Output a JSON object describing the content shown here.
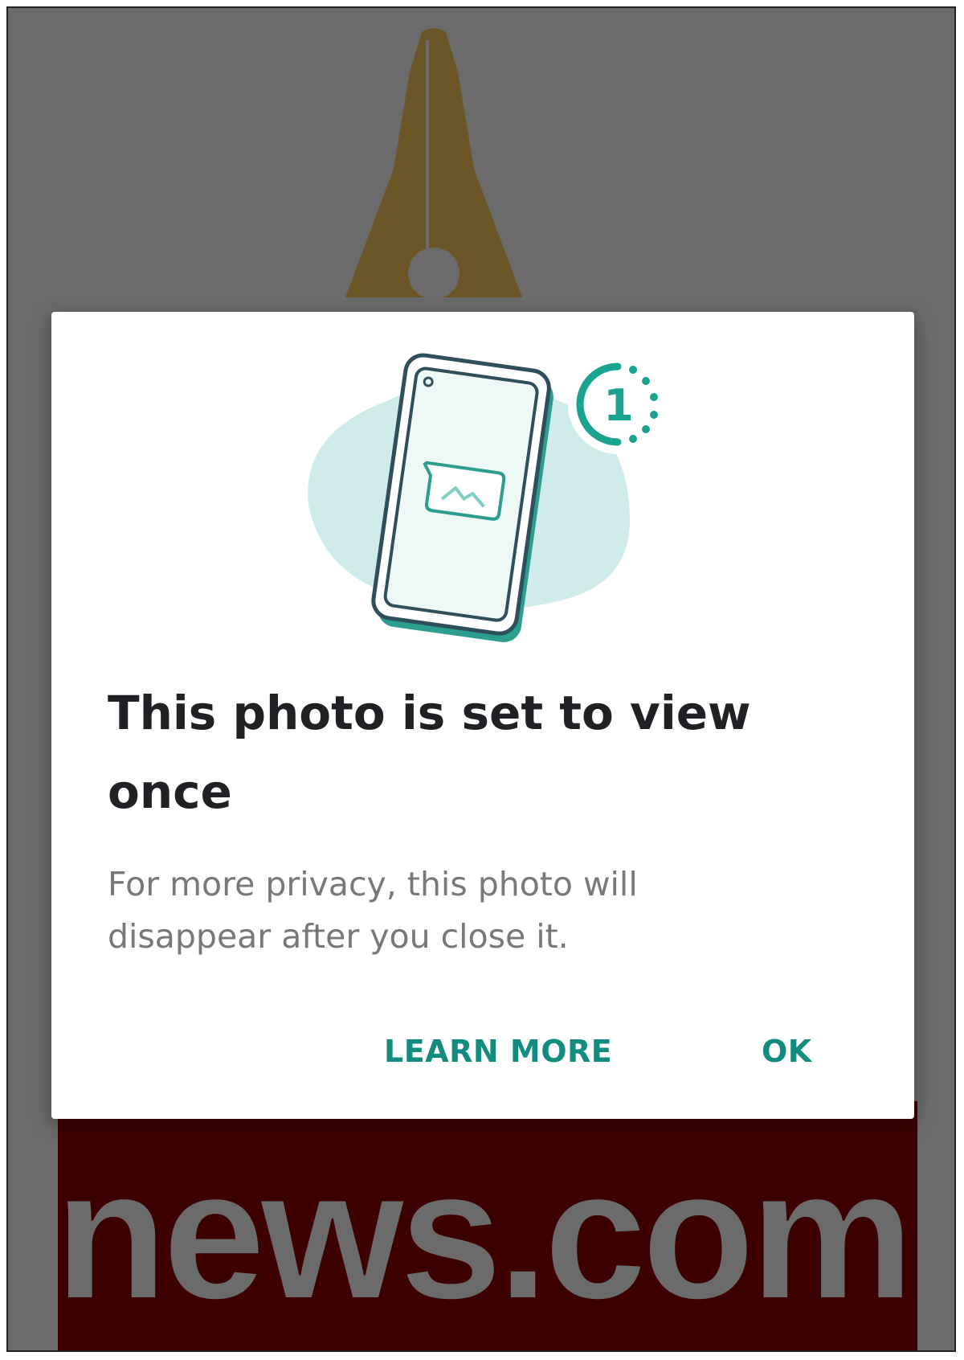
{
  "background": {
    "watermark_text": "news.com",
    "brand_color": "#8a6a1e",
    "banner_color": "#4a0000"
  },
  "dialog": {
    "icon": "view-once-photo-icon",
    "accent_color": "#128c7e",
    "badge_number": "1",
    "title": "This photo is set to view once",
    "body": "For more privacy, this photo will disappear after you close it.",
    "buttons": {
      "learn_more": "LEARN MORE",
      "ok": "OK"
    }
  }
}
